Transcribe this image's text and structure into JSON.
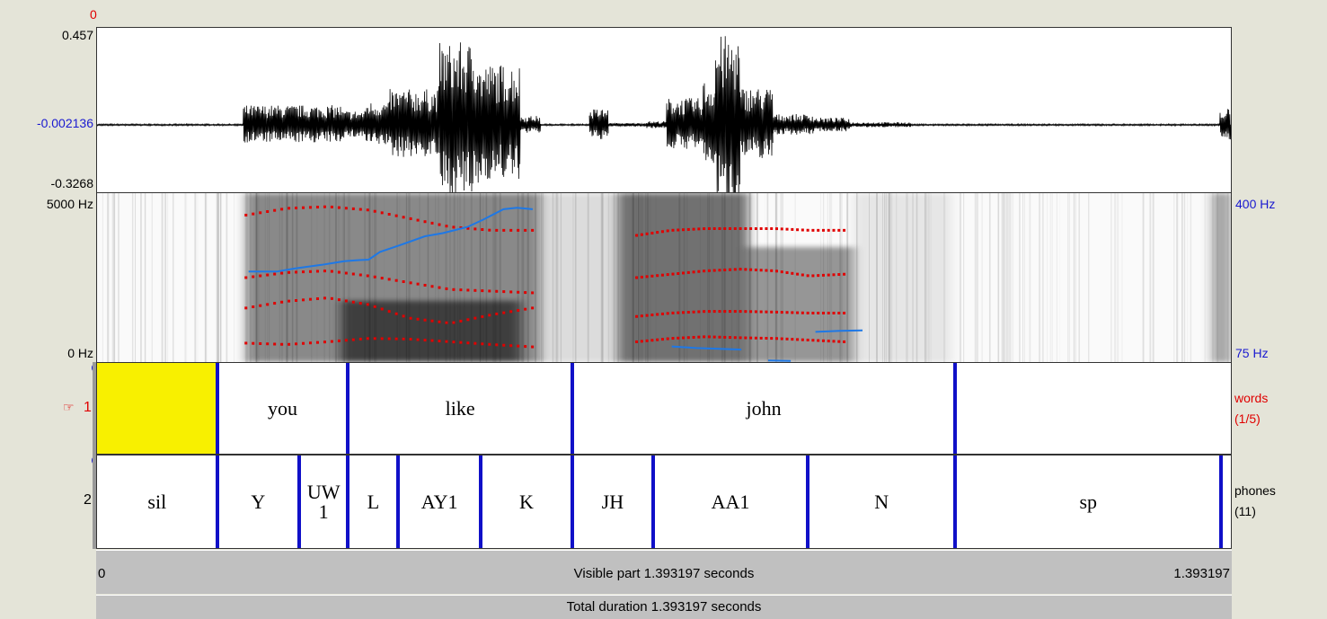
{
  "time_cursor_label": "0",
  "waveform": {
    "max_label": "0.457",
    "mid_label": "-0.002136",
    "min_label": "-0.3268"
  },
  "spectrogram": {
    "freq_top_label": "5000 Hz",
    "freq_bottom_label": "0 Hz",
    "pitch_top_label": "400 Hz",
    "pitch_bottom_label": "75 Hz"
  },
  "tiers": [
    {
      "number": "1",
      "name": "words",
      "count": "(1/5)",
      "intervals": [
        {
          "text": "",
          "start": 0.0,
          "end": 0.1475,
          "selected": true
        },
        {
          "text": "you",
          "start": 0.1475,
          "end": 0.3085
        },
        {
          "text": "like",
          "start": 0.3085,
          "end": 0.5839
        },
        {
          "text": "john",
          "start": 0.5839,
          "end": 1.0545
        },
        {
          "text": "",
          "start": 1.0545,
          "end": 1.393197
        }
      ]
    },
    {
      "number": "2",
      "name": "phones",
      "count": "(11)",
      "intervals": [
        {
          "text": "sil",
          "start": 0.0,
          "end": 0.1475
        },
        {
          "text": "Y",
          "start": 0.1475,
          "end": 0.2483
        },
        {
          "text": "UW1",
          "start": 0.2483,
          "end": 0.3085
        },
        {
          "text": "L",
          "start": 0.3085,
          "end": 0.3703
        },
        {
          "text": "AY1",
          "start": 0.3703,
          "end": 0.4713
        },
        {
          "text": "K",
          "start": 0.4713,
          "end": 0.5839
        },
        {
          "text": "JH",
          "start": 0.5839,
          "end": 0.6832
        },
        {
          "text": "AA1",
          "start": 0.6832,
          "end": 0.8735
        },
        {
          "text": "N",
          "start": 0.8735,
          "end": 1.0545
        },
        {
          "text": "sp",
          "start": 1.0545,
          "end": 1.3815
        },
        {
          "text": "",
          "start": 1.3815,
          "end": 1.393197
        }
      ]
    }
  ],
  "visible_bar": {
    "start_label": "0",
    "center_label": "Visible part 1.393197 seconds",
    "end_label": "1.393197"
  },
  "total_bar": {
    "label": "Total duration 1.393197 seconds"
  },
  "colors": {
    "boundary": "#1010c8",
    "selection": "#f8f000",
    "formant": "#e00000",
    "pitch": "#1e78e6"
  },
  "pitch_track": [
    {
      "t": 0.1862,
      "hz": 249
    },
    {
      "t": 0.2207,
      "hz": 249
    },
    {
      "t": 0.2428,
      "hz": 255
    },
    {
      "t": 0.2759,
      "hz": 262
    },
    {
      "t": 0.3035,
      "hz": 269
    },
    {
      "t": 0.32,
      "hz": 271
    },
    {
      "t": 0.3338,
      "hz": 272
    },
    {
      "t": 0.3476,
      "hz": 287
    },
    {
      "t": 0.3725,
      "hz": 300
    },
    {
      "t": 0.4028,
      "hz": 317
    },
    {
      "t": 0.4249,
      "hz": 323
    },
    {
      "t": 0.4552,
      "hz": 335
    },
    {
      "t": 0.4745,
      "hz": 349
    },
    {
      "t": 0.4994,
      "hz": 369
    },
    {
      "t": 0.516,
      "hz": 372
    },
    {
      "t": 0.5353,
      "hz": 369
    },
    {
      "t": 0.7062,
      "hz": 105
    },
    {
      "t": 0.7365,
      "hz": 102
    },
    {
      "t": 0.7724,
      "hz": 100
    },
    {
      "t": 0.7916,
      "hz": 99
    },
    {
      "t": 0.8247,
      "hz": 78
    },
    {
      "t": 0.8524,
      "hz": 77
    },
    {
      "t": 0.8827,
      "hz": 133
    },
    {
      "t": 0.913,
      "hz": 135
    },
    {
      "t": 0.9406,
      "hz": 136
    }
  ],
  "formant_tracks": [
    {
      "t0": 0.183,
      "t1": 0.535,
      "f": [
        560,
        520,
        600,
        700,
        680,
        600,
        520,
        450
      ]
    },
    {
      "t0": 0.183,
      "t1": 0.535,
      "f": [
        1600,
        1800,
        1900,
        1700,
        1300,
        1150,
        1400,
        1600
      ]
    },
    {
      "t0": 0.183,
      "t1": 0.535,
      "f": [
        2500,
        2650,
        2700,
        2550,
        2350,
        2150,
        2100,
        2050
      ]
    },
    {
      "t0": 0.183,
      "t1": 0.535,
      "f": [
        4350,
        4550,
        4600,
        4500,
        4250,
        4000,
        3900,
        3900
      ]
    },
    {
      "t0": 0.663,
      "t1": 0.918,
      "f": [
        600,
        700,
        750,
        720,
        700,
        650,
        600
      ]
    },
    {
      "t0": 0.663,
      "t1": 0.918,
      "f": [
        1350,
        1450,
        1500,
        1500,
        1480,
        1450,
        1450
      ]
    },
    {
      "t0": 0.663,
      "t1": 0.918,
      "f": [
        2500,
        2600,
        2700,
        2750,
        2700,
        2550,
        2600
      ]
    },
    {
      "t0": 0.663,
      "t1": 0.918,
      "f": [
        3750,
        3900,
        3950,
        3950,
        3950,
        3900,
        3900
      ]
    }
  ]
}
